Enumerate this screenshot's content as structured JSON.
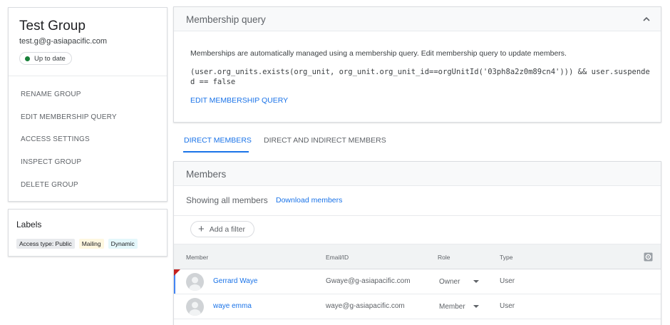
{
  "group": {
    "title": "Test Group",
    "email": "test.g@g-asiapacific.com",
    "status": "Up to date",
    "status_color": "#188038"
  },
  "actions": [
    {
      "label": "RENAME GROUP"
    },
    {
      "label": "EDIT MEMBERSHIP QUERY"
    },
    {
      "label": "ACCESS SETTINGS"
    },
    {
      "label": "INSPECT GROUP"
    },
    {
      "label": "DELETE GROUP"
    }
  ],
  "labels": {
    "title": "Labels",
    "chips": [
      {
        "label": "Access type: Public",
        "bg": "#e8eaed"
      },
      {
        "label": "Mailing",
        "bg": "#fef7e0"
      },
      {
        "label": "Dynamic",
        "bg": "#e4f7fb"
      }
    ]
  },
  "query": {
    "title": "Membership query",
    "description": "Memberships are automatically managed using a membership query. Edit membership query to update members.",
    "code": "(user.org_units.exists(org_unit, org_unit.org_unit_id==orgUnitId('03ph8a2z0m89cn4'))) && user.suspended == false",
    "edit_label": "EDIT MEMBERSHIP QUERY",
    "collapse_icon": "chevron-up-icon"
  },
  "tabs": [
    {
      "label": "DIRECT MEMBERS",
      "active": true
    },
    {
      "label": "DIRECT AND INDIRECT MEMBERS",
      "active": false
    }
  ],
  "members": {
    "title": "Members",
    "showing": "Showing all members",
    "download": "Download members",
    "add_filter": "Add a filter",
    "columns": [
      "Member",
      "Email/ID",
      "Role",
      "Type"
    ],
    "rows": [
      {
        "name": "Gerrard Waye",
        "email": "Gwaye@g-asiapacific.com",
        "role": "Owner",
        "type": "User"
      },
      {
        "name": "waye emma",
        "email": "waye@g-asiapacific.com",
        "role": "Member",
        "type": "User"
      }
    ]
  },
  "colors": {
    "accent": "#1a73e8",
    "flag": "#c5221f"
  }
}
